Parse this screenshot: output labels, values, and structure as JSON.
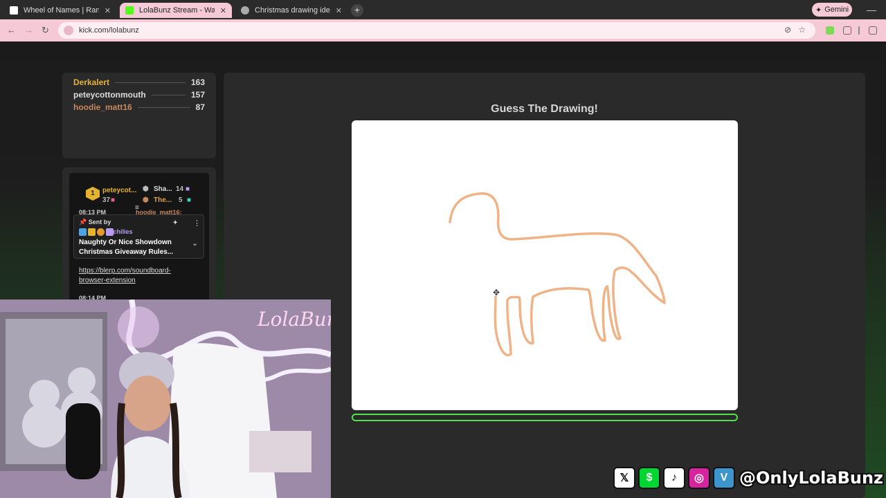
{
  "browser": {
    "tabs": [
      {
        "title": "Wheel of Names | Random nam",
        "icon": "google-icon"
      },
      {
        "title": "LolaBunz Stream - Watch Live o",
        "icon": "kick-icon",
        "active": true
      },
      {
        "title": "Christmas drawing ideas",
        "icon": "globe-icon"
      }
    ],
    "new_tab": "+",
    "gemini_label": "Gemini",
    "url": "kick.com/lolabunz"
  },
  "leaderboard": [
    {
      "name": "Derkalert",
      "score": "163",
      "color": "#e6b32e"
    },
    {
      "name": "peteycottonmouth",
      "score": "157",
      "color": "#dddddd"
    },
    {
      "name": "hoodie_matt16",
      "score": "87",
      "color": "#c7875a"
    }
  ],
  "chat": {
    "top_rank": "1",
    "top_user": "peteycot...",
    "top_count": "37",
    "second_user": "Sha...",
    "second_count": "14",
    "third_user": "The...",
    "third_count": "5",
    "clipped_line": "08:13 PM",
    "clipped_user": "hoodie_matt16:",
    "pinned": {
      "sent_by": "Sent by",
      "user": "Achilies",
      "message": "Naughty Or Nice Showdown Christmas Giveaway Rules..."
    },
    "link": "https://blerp.com/soundboard-browser-extension",
    "timestamp": "08:14 PM"
  },
  "game": {
    "title": "Guess The Drawing!",
    "timer_fraction": 0
  },
  "overlay": {
    "handle": "@OnlyLolaBunz",
    "cam_sign": "LolaBunz",
    "socials": [
      {
        "icon": "x-icon",
        "glyph": "𝕏"
      },
      {
        "icon": "cashapp-icon",
        "glyph": "$"
      },
      {
        "icon": "tiktok-icon",
        "glyph": "♪"
      },
      {
        "icon": "instagram-icon",
        "glyph": "◎"
      },
      {
        "icon": "venmo-icon",
        "glyph": "V"
      }
    ]
  },
  "colors": {
    "accent_pink": "#f6c9d6",
    "progress_green": "#53e34a",
    "stroke_orange": "#f0b287"
  }
}
